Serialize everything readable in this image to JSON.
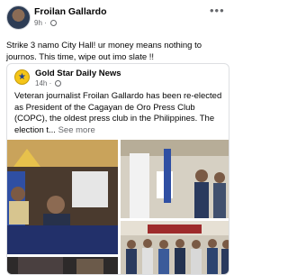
{
  "post": {
    "author": "Froilan Gallardo",
    "time": "9h",
    "privacy_icon": "globe-icon",
    "more_icon": "more-options-icon",
    "text": "Strike 3 namo City Hall! ur money means nothing to journos. This time, wipe out imo slate !!"
  },
  "shared": {
    "page_name": "Gold Star Daily News",
    "time": "14h",
    "text": "Veteran journalist Froilan Gallardo has been re-elected as President of the Cagayan de Oro Press Club (COPC), the oldest press club in the Philippines. The election t...",
    "see_more": "See more"
  }
}
